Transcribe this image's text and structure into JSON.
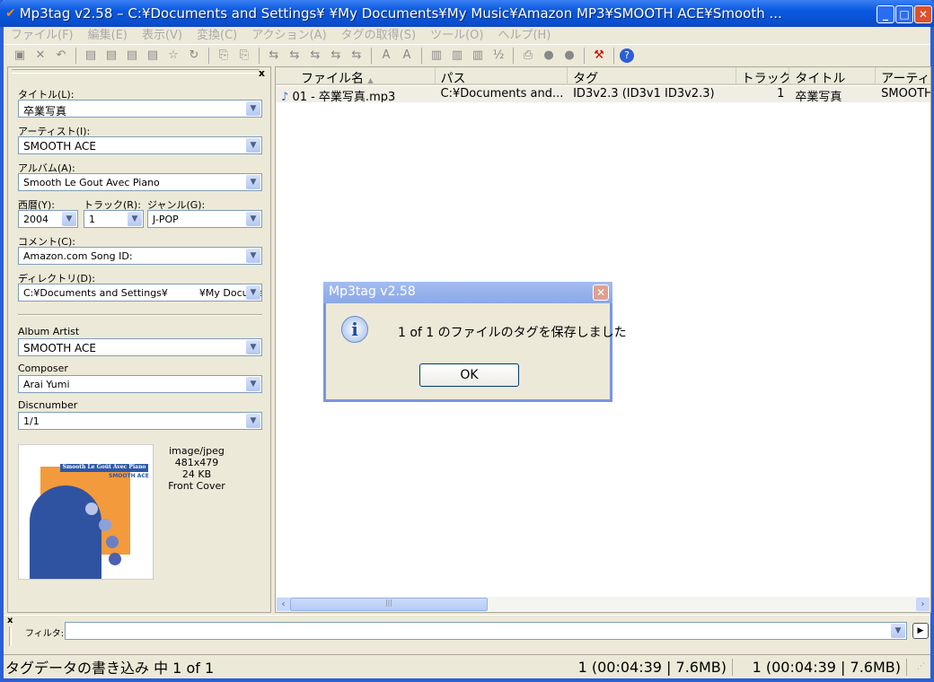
{
  "window": {
    "title": "Mp3tag v2.58  –  C:¥Documents and Settings¥          ¥My Documents¥My Music¥Amazon MP3¥SMOOTH  ACE¥Smooth ..."
  },
  "menu": [
    "ファイル(F)",
    "編集(E)",
    "表示(V)",
    "変換(C)",
    "アクション(A)",
    "タグの取得(S)",
    "ツール(O)",
    "ヘルプ(H)"
  ],
  "tag_panel": {
    "title_label": "タイトル(L):",
    "title_value": "卒業写真",
    "artist_label": "アーティスト(I):",
    "artist_value": "SMOOTH  ACE",
    "album_label": "アルバム(A):",
    "album_value": "Smooth Le Gout Avec Piano",
    "year_label": "西暦(Y):",
    "year_value": "2004",
    "track_label": "トラック(R):",
    "track_value": "1",
    "genre_label": "ジャンル(G):",
    "genre_value": "J-POP",
    "comment_label": "コメント(C):",
    "comment_value": "Amazon.com Song ID:",
    "directory_label": "ディレクトリ(D):",
    "directory_value": "C:¥Documents and Settings¥          ¥My Documents",
    "album_artist_label": "Album Artist",
    "album_artist_value": "SMOOTH  ACE",
    "composer_label": "Composer",
    "composer_value": "Arai Yumi",
    "discnumber_label": "Discnumber",
    "discnumber_value": "1/1",
    "cover": {
      "mime": "image/jpeg",
      "dimensions": "481x479",
      "size": "24 KB",
      "type": "Front Cover",
      "art_title": "Smooth Le Goût Avec Piano",
      "art_artist": "SMOOTH ACE"
    }
  },
  "file_list": {
    "columns": [
      "ファイル名",
      "パス",
      "タグ",
      "トラック",
      "タイトル",
      "アーティスト"
    ],
    "rows": [
      {
        "filename": "01 - 卒業写真.mp3",
        "path": "C:¥Documents and...",
        "tag": "ID3v2.3 (ID3v1 ID3v2.3)",
        "track": "1",
        "title": "卒業写真",
        "artist": "SMOOTH"
      }
    ]
  },
  "filter": {
    "label": "フィルタ:",
    "value": ""
  },
  "status": {
    "message": "タグデータの書き込み 中 1 of 1",
    "selected": "1 (00:04:39 | 7.6MB)",
    "total": "1 (00:04:39 | 7.6MB)"
  },
  "dialog": {
    "title": "Mp3tag v2.58",
    "message": "1 of 1 のファイルのタグを保存しました",
    "ok": "OK"
  }
}
